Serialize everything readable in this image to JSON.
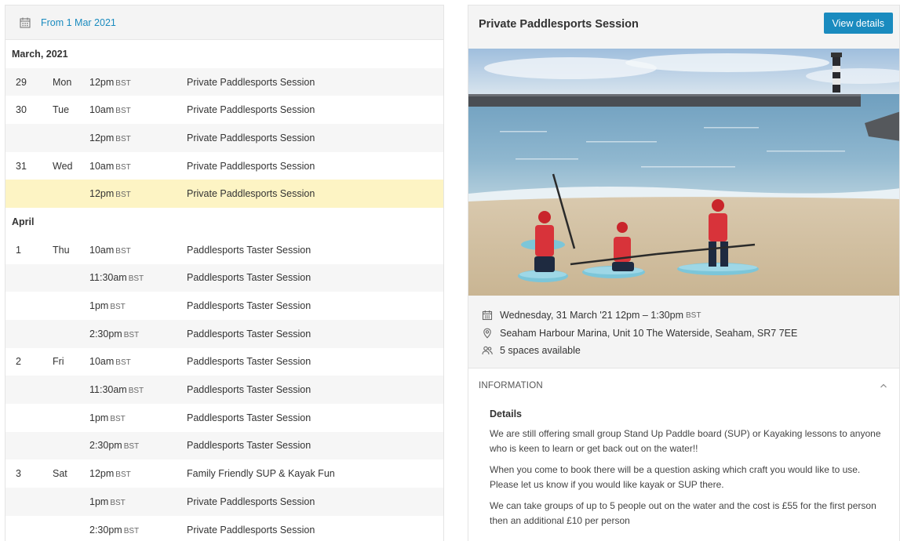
{
  "left": {
    "from_label": "From 1 Mar 2021",
    "months": [
      {
        "label": "March, 2021",
        "rows": [
          {
            "day": "29",
            "dow": "Mon",
            "time": "12pm",
            "tz": "BST",
            "name": "Private Paddlesports Session"
          },
          {
            "day": "30",
            "dow": "Tue",
            "time": "10am",
            "tz": "BST",
            "name": "Private Paddlesports Session"
          },
          {
            "day": "",
            "dow": "",
            "time": "12pm",
            "tz": "BST",
            "name": "Private Paddlesports Session"
          },
          {
            "day": "31",
            "dow": "Wed",
            "time": "10am",
            "tz": "BST",
            "name": "Private Paddlesports Session"
          },
          {
            "day": "",
            "dow": "",
            "time": "12pm",
            "tz": "BST",
            "name": "Private Paddlesports Session",
            "selected": true
          }
        ]
      },
      {
        "label": "April",
        "rows": [
          {
            "day": "1",
            "dow": "Thu",
            "time": "10am",
            "tz": "BST",
            "name": "Paddlesports Taster Session"
          },
          {
            "day": "",
            "dow": "",
            "time": "11:30am",
            "tz": "BST",
            "name": "Paddlesports Taster Session"
          },
          {
            "day": "",
            "dow": "",
            "time": "1pm",
            "tz": "BST",
            "name": "Paddlesports Taster Session"
          },
          {
            "day": "",
            "dow": "",
            "time": "2:30pm",
            "tz": "BST",
            "name": "Paddlesports Taster Session"
          },
          {
            "day": "2",
            "dow": "Fri",
            "time": "10am",
            "tz": "BST",
            "name": "Paddlesports Taster Session"
          },
          {
            "day": "",
            "dow": "",
            "time": "11:30am",
            "tz": "BST",
            "name": "Paddlesports Taster Session"
          },
          {
            "day": "",
            "dow": "",
            "time": "1pm",
            "tz": "BST",
            "name": "Paddlesports Taster Session"
          },
          {
            "day": "",
            "dow": "",
            "time": "2:30pm",
            "tz": "BST",
            "name": "Paddlesports Taster Session"
          },
          {
            "day": "3",
            "dow": "Sat",
            "time": "12pm",
            "tz": "BST",
            "name": "Family Friendly SUP & Kayak Fun"
          },
          {
            "day": "",
            "dow": "",
            "time": "1pm",
            "tz": "BST",
            "name": "Private Paddlesports Session"
          },
          {
            "day": "",
            "dow": "",
            "time": "2:30pm",
            "tz": "BST",
            "name": "Private Paddlesports Session"
          }
        ]
      }
    ]
  },
  "right": {
    "title": "Private Paddlesports Session",
    "view_details_label": "View details",
    "date_text": "Wednesday, 31 March '21  12pm – 1:30pm",
    "date_tz": "BST",
    "location": "Seaham Harbour Marina, Unit 10 The Waterside, Seaham, SR7 7EE",
    "spaces": "5 spaces available",
    "info_label": "INFORMATION",
    "details_heading": "Details",
    "paragraphs": [
      "We are still offering small group Stand Up Paddle board (SUP) or Kayaking lessons to anyone who is keen to learn or get back out on the water!!",
      "When you come to book there will be a question asking which craft you would like to use. Please let us know if you would like kayak or SUP there.",
      "We can take groups of up to 5 people out on the water and the cost is £55 for the first person then an additional £10 per person"
    ]
  },
  "colors": {
    "accent": "#1a8bbf",
    "selected_row": "#fdf4c4",
    "striped_row": "#f6f6f6"
  },
  "icons": {
    "calendar": "calendar-icon",
    "location": "location-pin-icon",
    "people": "people-icon",
    "chevron": "chevron-up-icon"
  }
}
